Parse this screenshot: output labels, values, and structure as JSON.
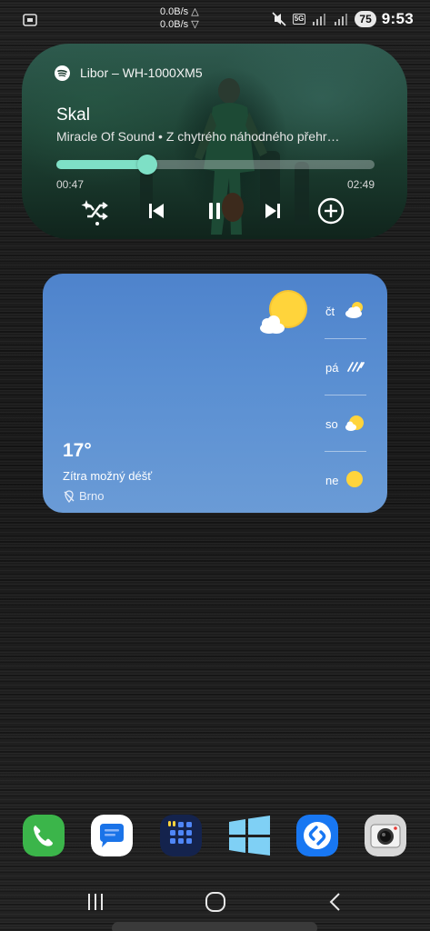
{
  "status_bar": {
    "left_icon": "screenshot-icon",
    "net_speed_up": "0.0B/s △",
    "net_speed_down": "0.0B/s ▽",
    "icons": [
      "mute-vibrate-icon",
      "5g-icon",
      "signal-icon",
      "signal-icon"
    ],
    "network_tag": "5G",
    "battery": "75",
    "time": "9:53"
  },
  "music_widget": {
    "app_icon": "spotify-icon",
    "device": "Libor – WH-1000XM5",
    "title": "Skal",
    "subtitle": "Miracle Of Sound • Z chytrého náhodného přehr…",
    "elapsed": "00:47",
    "total": "02:49",
    "progress": 0.286,
    "controls": [
      "smart-shuffle-icon",
      "previous-icon",
      "pause-icon",
      "next-icon",
      "add-icon"
    ],
    "accent": "#7ee0c6"
  },
  "weather_widget": {
    "temperature": "17°",
    "forecast_text": "Zítra možný déšť",
    "location": "Brno",
    "location_icon": "location-off-icon",
    "current_icon": "partly-sunny-icon",
    "days": [
      {
        "name": "čt",
        "icon": "partly-cloudy-icon"
      },
      {
        "name": "pá",
        "icon": "rain-icon"
      },
      {
        "name": "so",
        "icon": "sun-cloud-icon"
      },
      {
        "name": "ne",
        "icon": "sun-icon"
      }
    ]
  },
  "dock": {
    "apps": [
      {
        "name": "phone-app",
        "icon": "phone-icon",
        "color": "#3bb54a"
      },
      {
        "name": "messages-app",
        "icon": "messages-icon",
        "color": "#ffffff"
      },
      {
        "name": "app-drawer",
        "icon": "grid-icon",
        "color": "#1f3f8a"
      },
      {
        "name": "windows-app",
        "icon": "windows-icon",
        "color": "#7fd0f5"
      },
      {
        "name": "shazam-app",
        "icon": "shazam-icon",
        "color": "#1877f2"
      },
      {
        "name": "camera-app",
        "icon": "camera-icon",
        "color": "#d8d8d8"
      }
    ]
  },
  "nav_bar": {
    "buttons": [
      "recents-icon",
      "home-icon",
      "back-icon"
    ]
  }
}
